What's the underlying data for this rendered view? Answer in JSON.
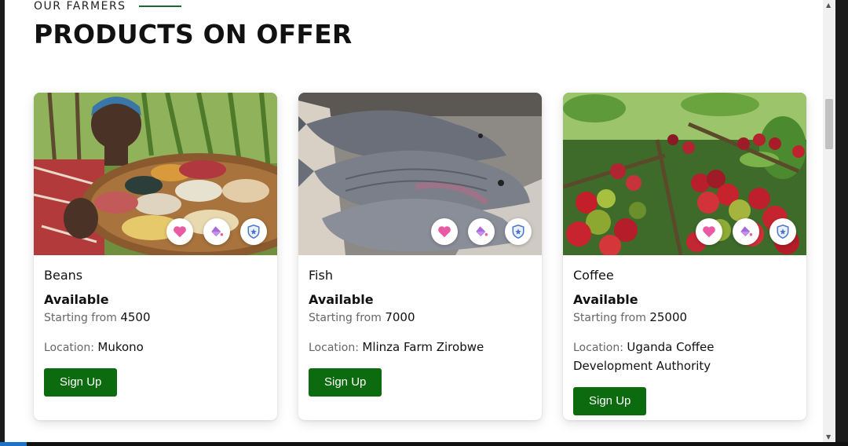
{
  "section": {
    "eyebrow": "OUR FARMERS",
    "title": "PRODUCTS ON OFFER"
  },
  "theme": {
    "accent": "#0c6b0f",
    "heart": "#e85aa3",
    "bucket": "#a86ad9",
    "shield": "#4a78c9"
  },
  "cards": [
    {
      "name": "Beans",
      "status": "Available",
      "price_label": "Starting from",
      "price": "4500",
      "location_label": "Location:",
      "location": "Mukono",
      "button": "Sign Up"
    },
    {
      "name": "Fish",
      "status": "Available",
      "price_label": "Starting from",
      "price": "7000",
      "location_label": "Location:",
      "location": "Mlinza Farm Zirobwe",
      "button": "Sign Up"
    },
    {
      "name": "Coffee",
      "status": "Available",
      "price_label": "Starting from",
      "price": "25000",
      "location_label": "Location:",
      "location": "Uganda Coffee Development Authority",
      "button": "Sign Up"
    }
  ],
  "icons": {
    "favorite": "heart-icon",
    "paint": "paint-bucket-icon",
    "secure": "shield-icon"
  }
}
